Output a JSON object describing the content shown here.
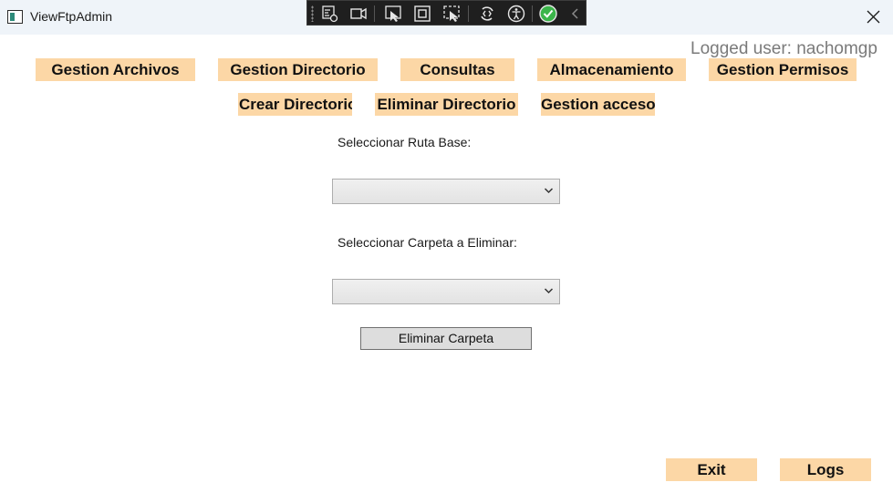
{
  "window": {
    "title": "ViewFtpAdmin"
  },
  "debug_toolbar": {
    "icons": [
      "select-element-icon",
      "record-icon",
      "pointer-select-icon",
      "layout-adorner-icon",
      "track-focus-icon",
      "hot-reload-icon",
      "accessibility-icon",
      "check-circle-icon",
      "collapse-chevron-icon"
    ]
  },
  "header": {
    "logged_user": "Logged user: nachomgp"
  },
  "nav": {
    "gestion_archivos": "Gestion Archivos",
    "gestion_directorio": "Gestion Directorio",
    "consultas": "Consultas",
    "almacenamiento": "Almacenamiento",
    "gestion_permisos": "Gestion Permisos"
  },
  "subnav": {
    "crear_directorio": "Crear Directorio",
    "eliminar_directorio": "Eliminar Directorio",
    "gestion_acceso": "Gestion acceso"
  },
  "form": {
    "ruta_base_label": "Seleccionar Ruta Base:",
    "ruta_base_value": "",
    "carpeta_label": "Seleccionar Carpeta a Eliminar:",
    "carpeta_value": "",
    "eliminar_button": "Eliminar Carpeta"
  },
  "footer": {
    "exit": "Exit",
    "logs": "Logs"
  },
  "colors": {
    "nav_button_bg": "#fcd7a6",
    "titlebar_bg": "#eff4f9",
    "check_green": "#3bb54a"
  }
}
